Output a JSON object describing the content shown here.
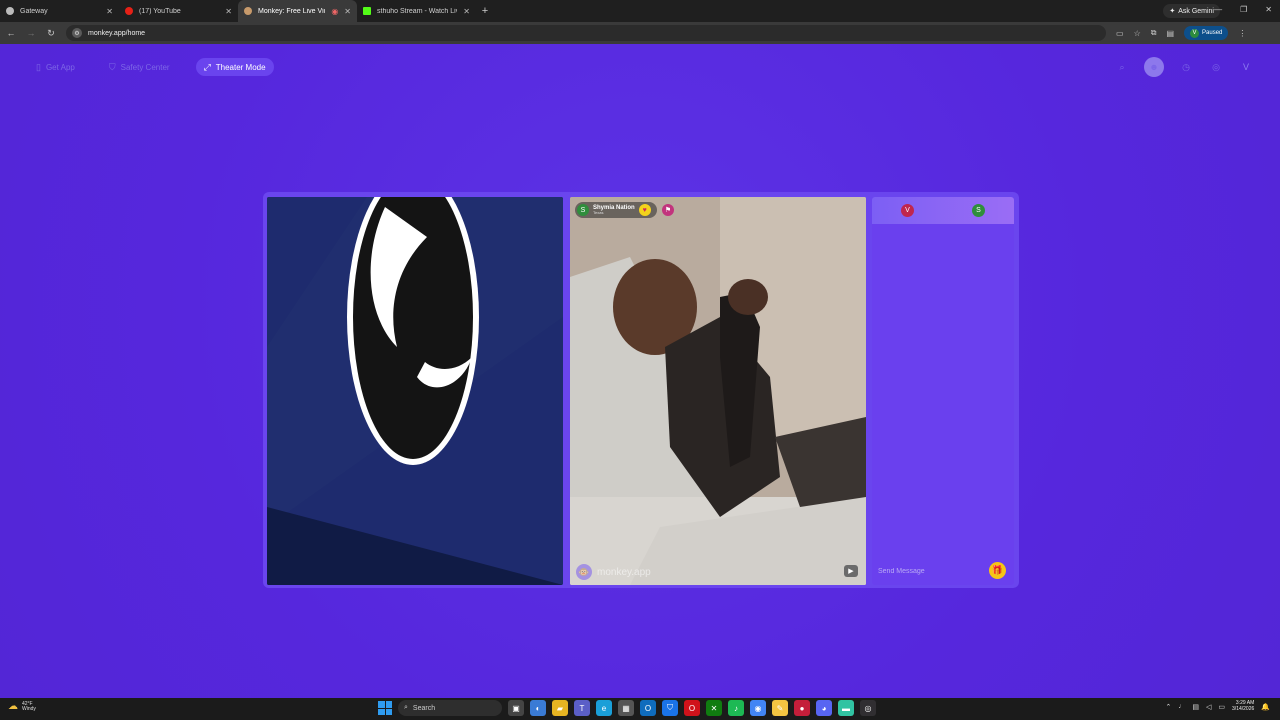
{
  "browser": {
    "tabs": [
      {
        "label": "Gateway",
        "favicon_color": "#bbbbbb",
        "active": false
      },
      {
        "label": "(17) YouTube",
        "favicon_color": "#e62117",
        "active": false
      },
      {
        "label": "Monkey: Free Live Video Ch",
        "favicon_color": "#c79a6b",
        "active": true
      },
      {
        "label": "sthuho Stream - Watch Live on",
        "favicon_color": "#53fc18",
        "active": false
      }
    ],
    "new_tab_glyph": "+",
    "ask_gemini": "Ask Gemini",
    "url": "monkey.app/home",
    "paused_label": "Paused",
    "profile_initial": "V"
  },
  "app": {
    "nav": {
      "get_app": "Get App",
      "safety_center": "Safety Center",
      "theater_mode": "Theater Mode"
    },
    "peer": {
      "name": "Shymia Nation",
      "location": "Texas",
      "initial": "S"
    },
    "watermark": "monkey.app",
    "chat": {
      "user_initial_self": "V",
      "user_initial_peer": "S",
      "self_color": "#c0264e",
      "peer_color": "#2f8e3c",
      "placeholder": "Send Message"
    },
    "header_profile_initial": "V"
  },
  "taskbar": {
    "weather_temp": "42°F",
    "weather_desc": "Windy",
    "search_label": "Search",
    "time": "3:29 AM",
    "date": "3/14/2026"
  }
}
